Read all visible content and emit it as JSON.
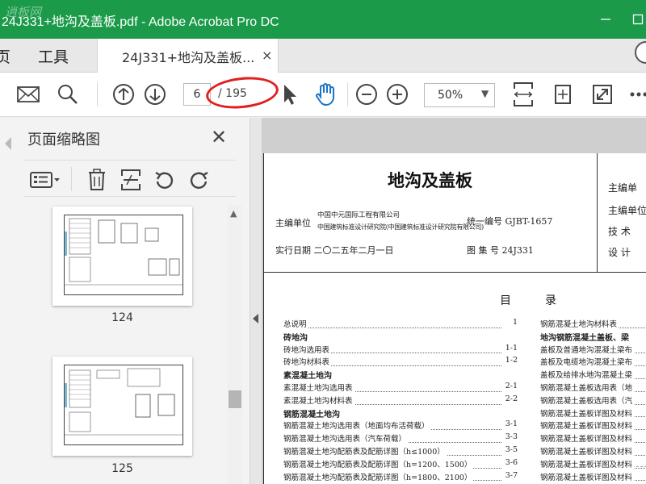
{
  "window": {
    "title": "24J331+地沟及盖板.pdf - Adobe Acrobat Pro DC",
    "watermark": "逍板网",
    "controls": [
      "minimize",
      "maximize"
    ]
  },
  "menu": {
    "home": "页",
    "tools": "工具"
  },
  "tab": {
    "label": "24J331+地沟及盖板...",
    "close": "×"
  },
  "toolbar": {
    "icons": [
      "mail-icon",
      "search-icon",
      "page-up-icon",
      "page-down-icon",
      "select-arrow-icon",
      "hand-tool-icon",
      "zoom-out-icon",
      "zoom-in-icon",
      "fit-width-icon",
      "rotate-view-icon",
      "fullscreen-icon",
      "more-icon"
    ],
    "page_current": "6",
    "page_total": "/ 195",
    "zoom": "50%"
  },
  "panel": {
    "title": "页面缩略图",
    "close": "✕",
    "tools": [
      "options-icon",
      "delete-icon",
      "extract-icon",
      "rotate-left-icon",
      "rotate-right-icon"
    ],
    "thumbnails": [
      {
        "label": "124"
      },
      {
        "label": "125"
      }
    ]
  },
  "document": {
    "title": "地沟及盖板",
    "editor_label": "主编单位",
    "editor_line1": "中国中元国际工程有限公司",
    "editor_line2": "中国建筑标准设计研究院(中国建筑标准设计研究院有限公司)",
    "code": "统一编号 GJBT-1657",
    "date": "实行日期 二〇二五年二月一日",
    "atlas": "图 集 号 24J331",
    "right_col": [
      "主编单",
      "主编单位",
      "技 术",
      "设 计"
    ],
    "toc_heading_left": "目",
    "toc_heading_right": "录",
    "toc_left": [
      {
        "text": "总说明",
        "page": "1",
        "bold": false
      },
      {
        "text": "砖地沟",
        "page": "",
        "bold": true
      },
      {
        "text": "砖地沟选用表",
        "page": "1-1",
        "bold": false
      },
      {
        "text": "砖地沟材料表",
        "page": "1-2",
        "bold": false
      },
      {
        "text": "素混凝土地沟",
        "page": "",
        "bold": true
      },
      {
        "text": "素混凝土地沟选用表",
        "page": "2-1",
        "bold": false
      },
      {
        "text": "素混凝土地沟材料表",
        "page": "2-2",
        "bold": false
      },
      {
        "text": "钢筋混凝土地沟",
        "page": "",
        "bold": true
      },
      {
        "text": "钢筋混凝土地沟选用表（地面均布活荷载）",
        "page": "3-1",
        "bold": false
      },
      {
        "text": "钢筋混凝土地沟选用表（汽车荷载）",
        "page": "3-3",
        "bold": false
      },
      {
        "text": "钢筋混凝土地沟配筋表及配筋详图（h≤1000）",
        "page": "3-5",
        "bold": false
      },
      {
        "text": "钢筋混凝土地沟配筋表及配筋详图（h=1200、1500）",
        "page": "3-6",
        "bold": false
      },
      {
        "text": "钢筋混凝土地沟配筋表及配筋详图（h=1800、2100）",
        "page": "3-7",
        "bold": false
      }
    ],
    "toc_right": [
      {
        "text": "钢筋混凝土地沟材料表",
        "bold": false
      },
      {
        "text": "地沟钢筋混凝土盖板、梁",
        "bold": true
      },
      {
        "text": "盖板及普通地沟混凝土梁布",
        "bold": false
      },
      {
        "text": "盖板及电缆地沟混凝土梁布",
        "bold": false
      },
      {
        "text": "盖板及给排水地沟混凝土梁",
        "bold": false
      },
      {
        "text": "钢筋混凝土盖板选用表（地",
        "bold": false
      },
      {
        "text": "钢筋混凝土盖板选用表（汽",
        "bold": false
      },
      {
        "text": "钢筋混凝土盖板详图及材料",
        "bold": false
      },
      {
        "text": "钢筋混凝土盖板详图及材料",
        "bold": false
      },
      {
        "text": "钢筋混凝土盖板详图及材料",
        "bold": false
      },
      {
        "text": "钢筋混凝土盖板详图及材料",
        "bold": false
      },
      {
        "text": "钢筋混凝土盖板详图及材料",
        "bold": false
      },
      {
        "text": "钢筋混凝土盖板详图及材料",
        "bold": false
      }
    ]
  }
}
